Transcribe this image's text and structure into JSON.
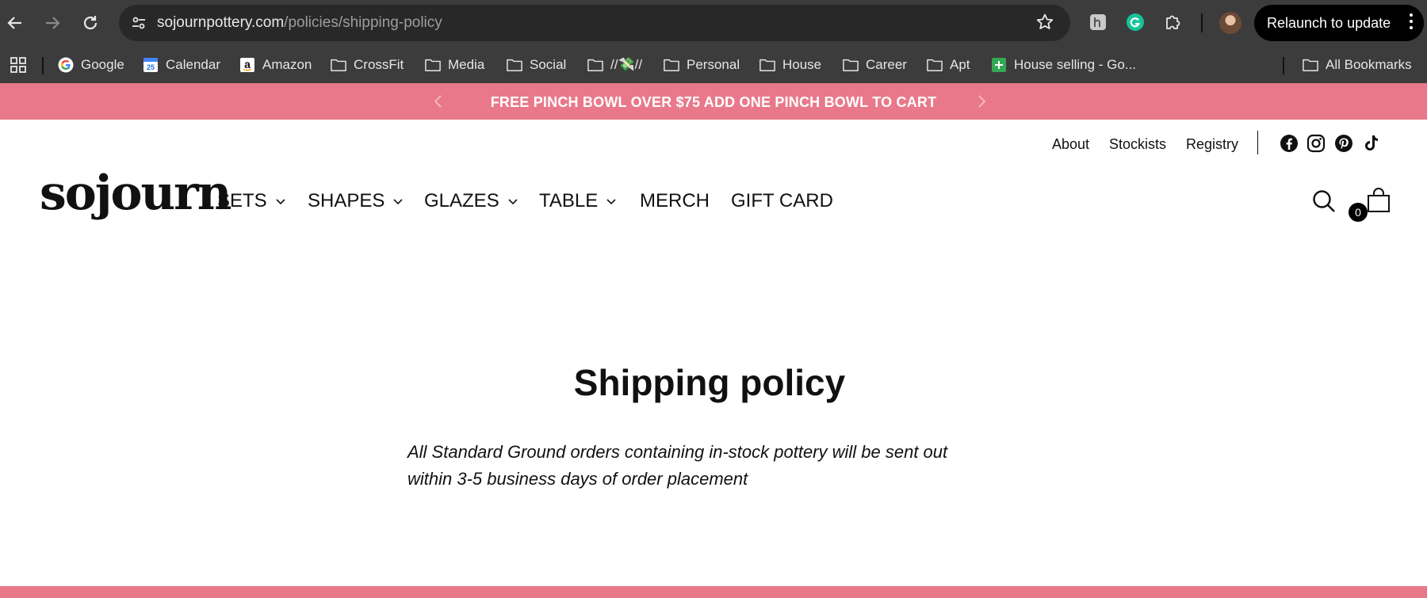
{
  "browser": {
    "url_domain": "sojournpottery.com",
    "url_path": "/policies/shipping-policy",
    "relaunch_label": "Relaunch to update",
    "extensions": [
      "honey-icon",
      "grammarly-icon",
      "puzzle-icon"
    ],
    "bookmarks": [
      {
        "label": "Google",
        "icon": "google-icon"
      },
      {
        "label": "Calendar",
        "icon": "calendar-icon"
      },
      {
        "label": "Amazon",
        "icon": "amazon-icon"
      },
      {
        "label": "CrossFit",
        "icon": "folder-icon"
      },
      {
        "label": "Media",
        "icon": "folder-icon"
      },
      {
        "label": "Social",
        "icon": "folder-icon"
      },
      {
        "label": "//💸//",
        "icon": "folder-icon"
      },
      {
        "label": "Personal",
        "icon": "folder-icon"
      },
      {
        "label": "House",
        "icon": "folder-icon"
      },
      {
        "label": "Career",
        "icon": "folder-icon"
      },
      {
        "label": "Apt",
        "icon": "folder-icon"
      },
      {
        "label": "House selling - Go...",
        "icon": "sheets-icon"
      }
    ],
    "all_bookmarks_label": "All Bookmarks",
    "calendar_day": "25"
  },
  "announcement": {
    "text": "FREE PINCH BOWL OVER $75 ADD ONE PINCH BOWL TO CART"
  },
  "header": {
    "utility_links": [
      "About",
      "Stockists",
      "Registry"
    ],
    "social": [
      "facebook-icon",
      "instagram-icon",
      "pinterest-icon",
      "tiktok-icon"
    ],
    "logo": "sojourn",
    "nav": [
      {
        "label": "SETS",
        "dropdown": true
      },
      {
        "label": "SHAPES",
        "dropdown": true
      },
      {
        "label": "GLAZES",
        "dropdown": true
      },
      {
        "label": "TABLE",
        "dropdown": true
      },
      {
        "label": "MERCH",
        "dropdown": false
      },
      {
        "label": "GIFT CARD",
        "dropdown": false
      }
    ],
    "cart_count": "0"
  },
  "main": {
    "title": "Shipping policy",
    "body": "All Standard Ground orders containing in-stock pottery will be sent out within 3-5 business days of order placement"
  },
  "colors": {
    "brand_pink": "#e9798a",
    "chrome_dark": "#3c3c3c"
  }
}
